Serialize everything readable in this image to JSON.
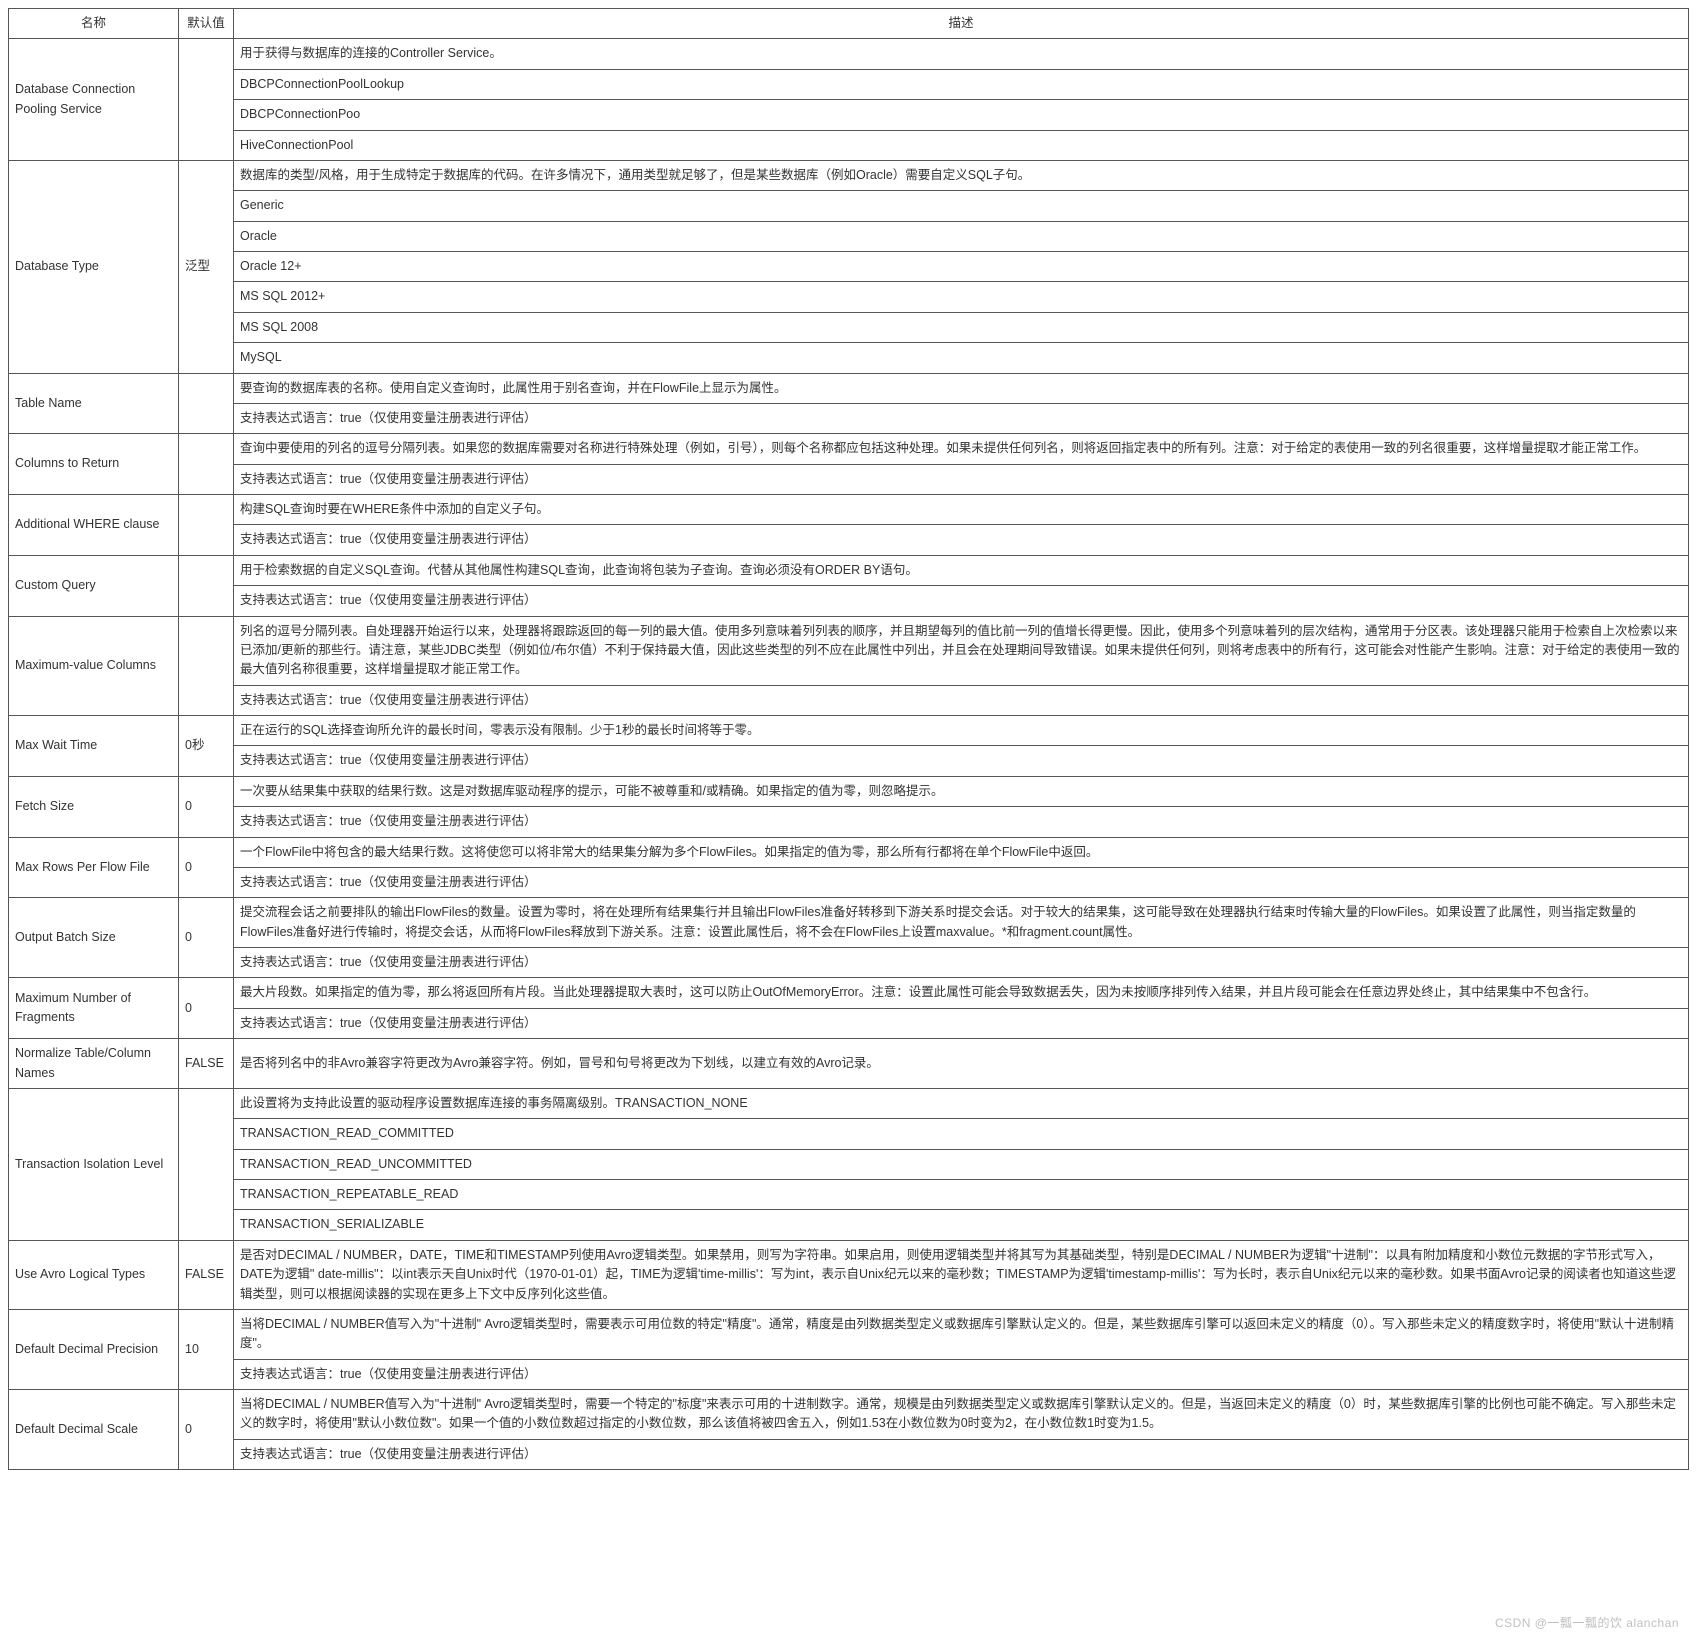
{
  "headers": {
    "name": "名称",
    "default": "默认值",
    "desc": "描述"
  },
  "expr_true": "支持表达式语言：true（仅使用变量注册表进行评估）",
  "rows": [
    {
      "name": "Database Connection Pooling Service",
      "default": "",
      "descs": [
        "用于获得与数据库的连接的Controller Service。",
        "DBCPConnectionPoolLookup",
        "DBCPConnectionPoo",
        "HiveConnectionPool"
      ]
    },
    {
      "name": "Database Type",
      "default": "泛型",
      "descs": [
        "数据库的类型/风格，用于生成特定于数据库的代码。在许多情况下，通用类型就足够了，但是某些数据库（例如Oracle）需要自定义SQL子句。",
        "Generic",
        "Oracle",
        "Oracle 12+",
        "MS SQL 2012+",
        "MS SQL 2008",
        "MySQL"
      ]
    },
    {
      "name": "Table Name",
      "default": "",
      "descs": [
        "要查询的数据库表的名称。使用自定义查询时，此属性用于别名查询，并在FlowFile上显示为属性。",
        "__EXPR__"
      ]
    },
    {
      "name": "Columns to Return",
      "default": "",
      "descs": [
        "查询中要使用的列名的逗号分隔列表。如果您的数据库需要对名称进行特殊处理（例如，引号），则每个名称都应包括这种处理。如果未提供任何列名，则将返回指定表中的所有列。注意：对于给定的表使用一致的列名很重要，这样增量提取才能正常工作。",
        "__EXPR__"
      ]
    },
    {
      "name": "Additional WHERE clause",
      "default": "",
      "descs": [
        "构建SQL查询时要在WHERE条件中添加的自定义子句。",
        "__EXPR__"
      ]
    },
    {
      "name": "Custom Query",
      "default": "",
      "descs": [
        "用于检索数据的自定义SQL查询。代替从其他属性构建SQL查询，此查询将包装为子查询。查询必须没有ORDER BY语句。",
        "__EXPR__"
      ]
    },
    {
      "name": "Maximum-value Columns",
      "default": "",
      "descs": [
        "列名的逗号分隔列表。自处理器开始运行以来，处理器将跟踪返回的每一列的最大值。使用多列意味着列列表的顺序，并且期望每列的值比前一列的值增长得更慢。因此，使用多个列意味着列的层次结构，通常用于分区表。该处理器只能用于检索自上次检索以来已添加/更新的那些行。请注意，某些JDBC类型（例如位/布尔值）不利于保持最大值，因此这些类型的列不应在此属性中列出，并且会在处理期间导致错误。如果未提供任何列，则将考虑表中的所有行，这可能会对性能产生影响。注意：对于给定的表使用一致的最大值列名称很重要，这样增量提取才能正常工作。",
        "__EXPR__"
      ]
    },
    {
      "name": "Max Wait Time",
      "default": "0秒",
      "descs": [
        "正在运行的SQL选择查询所允许的最长时间，零表示没有限制。少于1秒的最长时间将等于零。",
        "__EXPR__"
      ]
    },
    {
      "name": "Fetch Size",
      "default": "0",
      "descs": [
        "一次要从结果集中获取的结果行数。这是对数据库驱动程序的提示，可能不被尊重和/或精确。如果指定的值为零，则忽略提示。",
        "__EXPR__"
      ]
    },
    {
      "name": "Max Rows Per Flow File",
      "default": "0",
      "descs": [
        "一个FlowFile中将包含的最大结果行数。这将使您可以将非常大的结果集分解为多个FlowFiles。如果指定的值为零，那么所有行都将在单个FlowFile中返回。",
        "__EXPR__"
      ]
    },
    {
      "name": "Output Batch Size",
      "default": "0",
      "descs": [
        "提交流程会话之前要排队的输出FlowFiles的数量。设置为零时，将在处理所有结果集行并且输出FlowFiles准备好转移到下游关系时提交会话。对于较大的结果集，这可能导致在处理器执行结束时传输大量的FlowFiles。如果设置了此属性，则当指定数量的FlowFiles准备好进行传输时，将提交会话，从而将FlowFiles释放到下游关系。注意：设置此属性后，将不会在FlowFiles上设置maxvalue。*和fragment.count属性。",
        "__EXPR__"
      ]
    },
    {
      "name": "Maximum Number of Fragments",
      "default": "0",
      "descs": [
        "最大片段数。如果指定的值为零，那么将返回所有片段。当此处理器提取大表时，这可以防止OutOfMemoryError。注意：设置此属性可能会导致数据丢失，因为未按顺序排列传入结果，并且片段可能会在任意边界处终止，其中结果集中不包含行。",
        "__EXPR__"
      ]
    },
    {
      "name": "Normalize Table/Column Names",
      "default": "FALSE",
      "descs": [
        "是否将列名中的非Avro兼容字符更改为Avro兼容字符。例如，冒号和句号将更改为下划线，以建立有效的Avro记录。"
      ]
    },
    {
      "name": "Transaction Isolation Level",
      "default": "",
      "descs": [
        "此设置将为支持此设置的驱动程序设置数据库连接的事务隔离级别。TRANSACTION_NONE",
        "TRANSACTION_READ_COMMITTED",
        "TRANSACTION_READ_UNCOMMITTED",
        "TRANSACTION_REPEATABLE_READ",
        "TRANSACTION_SERIALIZABLE"
      ]
    },
    {
      "name": "Use Avro Logical Types",
      "default": "FALSE",
      "descs": [
        "是否对DECIMAL / NUMBER，DATE，TIME和TIMESTAMP列使用Avro逻辑类型。如果禁用，则写为字符串。如果启用，则使用逻辑类型并将其写为其基础类型，特别是DECIMAL / NUMBER为逻辑\"十进制\"：以具有附加精度和小数位元数据的字节形式写入，DATE为逻辑\" date-millis\"：以int表示天自Unix时代（1970-01-01）起，TIME为逻辑'time-millis'：写为int，表示自Unix纪元以来的毫秒数；TIMESTAMP为逻辑'timestamp-millis'：写为长时，表示自Unix纪元以来的毫秒数。如果书面Avro记录的阅读者也知道这些逻辑类型，则可以根据阅读器的实现在更多上下文中反序列化这些值。"
      ]
    },
    {
      "name": "Default Decimal Precision",
      "default": "10",
      "descs": [
        "当将DECIMAL / NUMBER值写入为\"十进制\" Avro逻辑类型时，需要表示可用位数的特定\"精度\"。通常，精度是由列数据类型定义或数据库引擎默认定义的。但是，某些数据库引擎可以返回未定义的精度（0）。写入那些未定义的精度数字时，将使用\"默认十进制精度\"。",
        "__EXPR__"
      ]
    },
    {
      "name": "Default Decimal Scale",
      "default": "0",
      "descs": [
        "当将DECIMAL / NUMBER值写入为\"十进制\" Avro逻辑类型时，需要一个特定的\"标度\"来表示可用的十进制数字。通常，规模是由列数据类型定义或数据库引擎默认定义的。但是，当返回未定义的精度（0）时，某些数据库引擎的比例也可能不确定。写入那些未定义的数字时，将使用\"默认小数位数\"。如果一个值的小数位数超过指定的小数位数，那么该值将被四舍五入，例如1.53在小数位数为0时变为2，在小数位数1时变为1.5。",
        "__EXPR__"
      ]
    }
  ],
  "watermark": "CSDN @一瓢一瓢的饮 alanchan"
}
